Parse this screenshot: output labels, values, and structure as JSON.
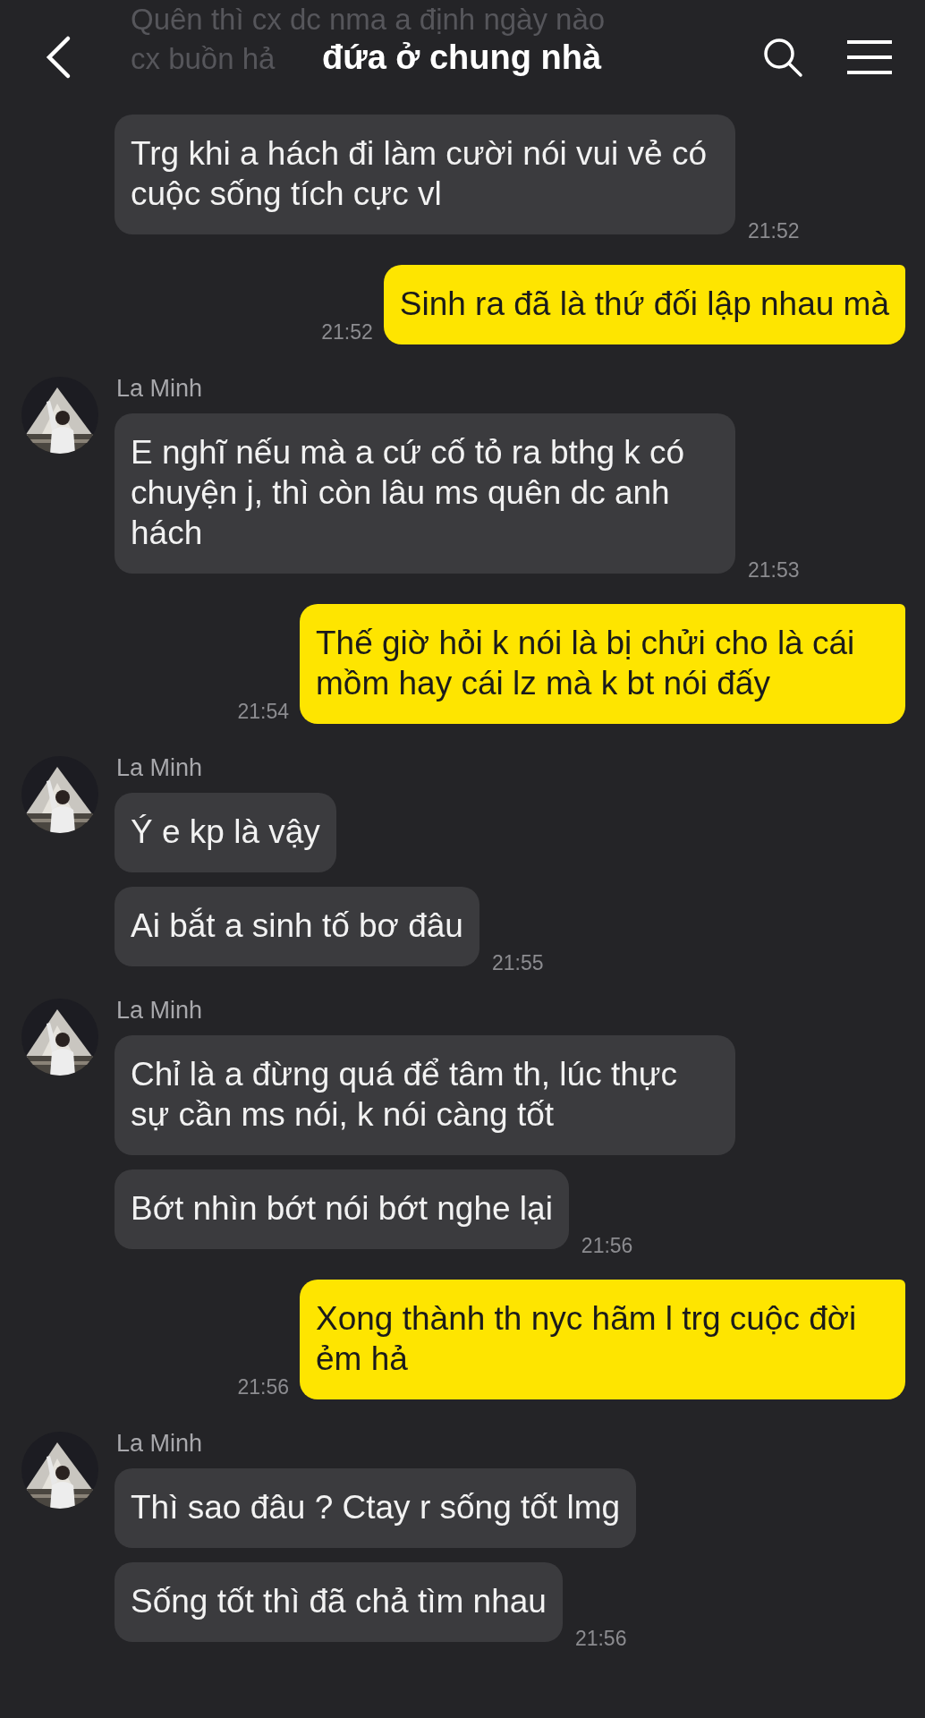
{
  "header": {
    "title": "đứa ở chung nhà",
    "faded_message_lines": [
      "Quên thì cx dc nma a định ngày nào",
      "cx buồn hả"
    ]
  },
  "messages": [
    {
      "kind": "received",
      "text": "Trg khi a hách đi làm cười nói vui vẻ có cuộc sống tích cực vl",
      "time": "21:52"
    },
    {
      "kind": "sent",
      "text": "Sinh ra đã là thứ đối lập nhau mà",
      "time": "21:52"
    },
    {
      "kind": "received",
      "sender": "La Minh",
      "text": "E nghĩ nếu mà a cứ cố tỏ ra bthg k có chuyện j, thì còn lâu ms quên dc anh hách",
      "time": "21:53"
    },
    {
      "kind": "sent",
      "text": "Thế giờ hỏi k nói là bị chửi cho là cái mồm hay cái lz mà k bt nói đấy",
      "time": "21:54"
    },
    {
      "kind": "received",
      "sender": "La Minh",
      "text": "Ý e kp là vậy"
    },
    {
      "kind": "received",
      "text": "Ai bắt a sinh tố bơ đâu",
      "time": "21:55"
    },
    {
      "kind": "received",
      "sender": "La Minh",
      "text": "Chỉ là a đừng quá để tâm th, lúc thực sự cần ms nói, k nói càng tốt"
    },
    {
      "kind": "received",
      "text": "Bớt nhìn bớt nói bớt nghe lại",
      "time": "21:56"
    },
    {
      "kind": "sent",
      "text": "Xong thành th nyc hãm l trg cuộc đời ẻm hả",
      "time": "21:56"
    },
    {
      "kind": "received",
      "sender": "La Minh",
      "text": "Thì sao đâu ? Ctay r sống tốt lmg"
    },
    {
      "kind": "received",
      "text": "Sống tốt thì đã chả tìm nhau",
      "time": "21:56"
    }
  ]
}
